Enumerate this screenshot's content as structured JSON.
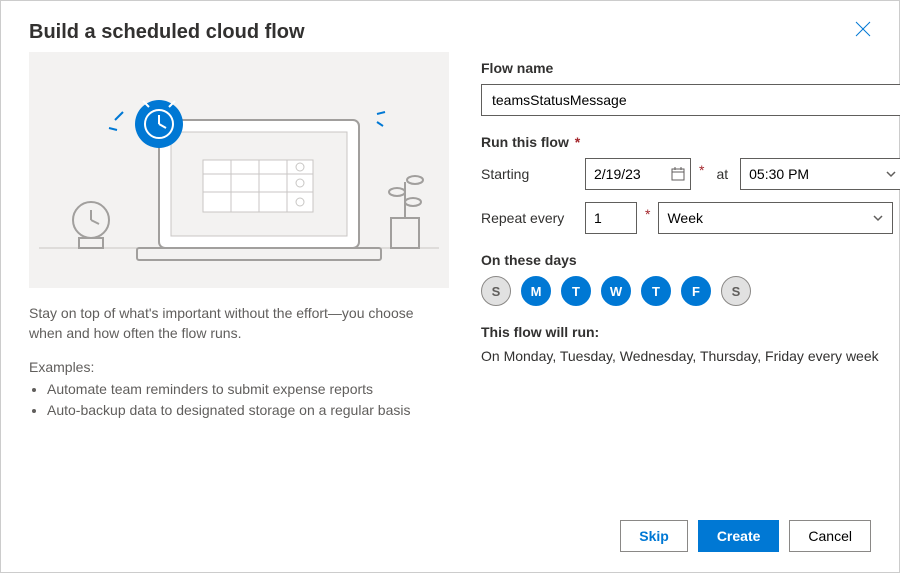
{
  "title": "Build a scheduled cloud flow",
  "description": "Stay on top of what's important without the effort—you choose when and how often the flow runs.",
  "examples_label": "Examples:",
  "examples": [
    "Automate team reminders to submit expense reports",
    "Auto-backup data to designated storage on a regular basis"
  ],
  "flow_name_label": "Flow name",
  "flow_name_value": "teamsStatusMessage",
  "run_this_flow_label": "Run this flow",
  "starting_label": "Starting",
  "starting_date": "2/19/23",
  "at_label": "at",
  "starting_time": "05:30 PM",
  "repeat_every_label": "Repeat every",
  "repeat_value": "1",
  "repeat_unit": "Week",
  "on_these_days_label": "On these days",
  "days": [
    {
      "letter": "S",
      "selected": false
    },
    {
      "letter": "M",
      "selected": true
    },
    {
      "letter": "T",
      "selected": true
    },
    {
      "letter": "W",
      "selected": true
    },
    {
      "letter": "T",
      "selected": true
    },
    {
      "letter": "F",
      "selected": true
    },
    {
      "letter": "S",
      "selected": false
    }
  ],
  "summary_label": "This flow will run:",
  "summary_text": "On Monday, Tuesday, Wednesday, Thursday, Friday every week",
  "skip_label": "Skip",
  "create_label": "Create",
  "cancel_label": "Cancel"
}
